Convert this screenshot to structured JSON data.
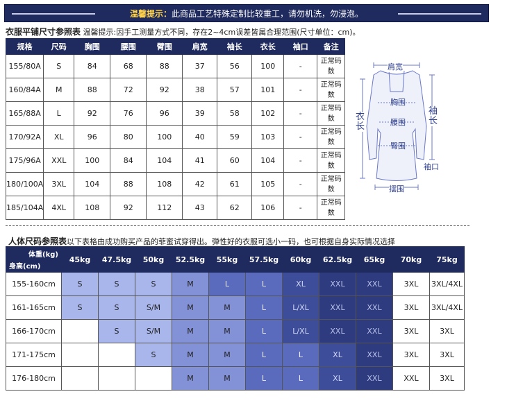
{
  "banner": {
    "highlight": "温馨提示：",
    "text": "此商品工艺特殊定制比较重工，请勿机洗，勿浸泡。"
  },
  "size_table": {
    "title": "衣服平铺尺寸参照表",
    "note": " 温馨提示:因手工测量方式不同，存在2~4cm误差皆属合理范围(尺寸单位：cm)。",
    "headers": [
      "规格",
      "尺码",
      "胸围",
      "腰围",
      "臂围",
      "肩宽",
      "袖长",
      "衣长",
      "袖口",
      "备注"
    ],
    "rows": [
      [
        "155/80A",
        "S",
        "84",
        "68",
        "88",
        "37",
        "56",
        "100",
        "-",
        "正常码数"
      ],
      [
        "160/84A",
        "M",
        "88",
        "72",
        "92",
        "38",
        "57",
        "101",
        "-",
        "正常码数"
      ],
      [
        "165/88A",
        "L",
        "92",
        "76",
        "96",
        "39",
        "58",
        "102",
        "-",
        "正常码数"
      ],
      [
        "170/92A",
        "XL",
        "96",
        "80",
        "100",
        "40",
        "59",
        "103",
        "-",
        "正常码数"
      ],
      [
        "175/96A",
        "XXL",
        "100",
        "84",
        "104",
        "41",
        "60",
        "104",
        "-",
        "正常码数"
      ],
      [
        "180/100A",
        "3XL",
        "104",
        "88",
        "108",
        "42",
        "61",
        "105",
        "-",
        "正常码数"
      ],
      [
        "185/104A",
        "4XL",
        "108",
        "92",
        "112",
        "43",
        "62",
        "106",
        "-",
        "正常码数"
      ]
    ]
  },
  "diagram": {
    "shoulder": "肩宽",
    "chest": "胸围",
    "waist": "腰围",
    "hip": "臀围",
    "hem": "摆围",
    "cuff": "袖口",
    "length": "衣长",
    "sleeve": "袖长"
  },
  "body_table": {
    "title": "人体尺码参照表",
    "note": "以下表格由成功购买产品的菲蜜试穿得出。弹性好的衣服可选小一码，也可根据自身实际情况选择",
    "corner_weight": "体重(kg)",
    "corner_height": "身高(cm)",
    "weights": [
      "45kg",
      "47.5kg",
      "50kg",
      "52.5kg",
      "55kg",
      "57.5kg",
      "60kg",
      "62.5kg",
      "65kg",
      "70kg",
      "75kg"
    ],
    "rows": [
      {
        "height": "155-160cm",
        "cells": [
          "S",
          "S",
          "S",
          "M",
          "L",
          "L",
          "XL",
          "XXL",
          "XXL",
          "3XL",
          "3XL/4XL"
        ],
        "shade": [
          1,
          1,
          1,
          2,
          3,
          3,
          4,
          5,
          5,
          0,
          0
        ]
      },
      {
        "height": "161-165cm",
        "cells": [
          "S",
          "S",
          "S/M",
          "M",
          "M",
          "L",
          "L/XL",
          "XXL",
          "XXL",
          "3XL",
          "3XL/4XL"
        ],
        "shade": [
          1,
          1,
          1,
          2,
          2,
          3,
          4,
          5,
          5,
          0,
          0
        ]
      },
      {
        "height": "166-170cm",
        "cells": [
          "",
          "S",
          "S/M",
          "M",
          "M",
          "L",
          "L/XL",
          "XXL",
          "XXL",
          "3XL",
          "3XL"
        ],
        "shade": [
          0,
          1,
          1,
          2,
          2,
          3,
          4,
          5,
          5,
          0,
          0
        ]
      },
      {
        "height": "171-175cm",
        "cells": [
          "",
          "",
          "S",
          "M",
          "M",
          "L",
          "L",
          "XL",
          "XXL",
          "3XL",
          "3XL"
        ],
        "shade": [
          0,
          0,
          1,
          2,
          2,
          3,
          3,
          4,
          5,
          0,
          0
        ]
      },
      {
        "height": "176-180cm",
        "cells": [
          "",
          "",
          "",
          "M",
          "M",
          "L",
          "L",
          "XL",
          "XXL",
          "XXL",
          "3XL"
        ],
        "shade": [
          0,
          0,
          0,
          2,
          2,
          3,
          3,
          4,
          5,
          0,
          0
        ]
      }
    ]
  }
}
